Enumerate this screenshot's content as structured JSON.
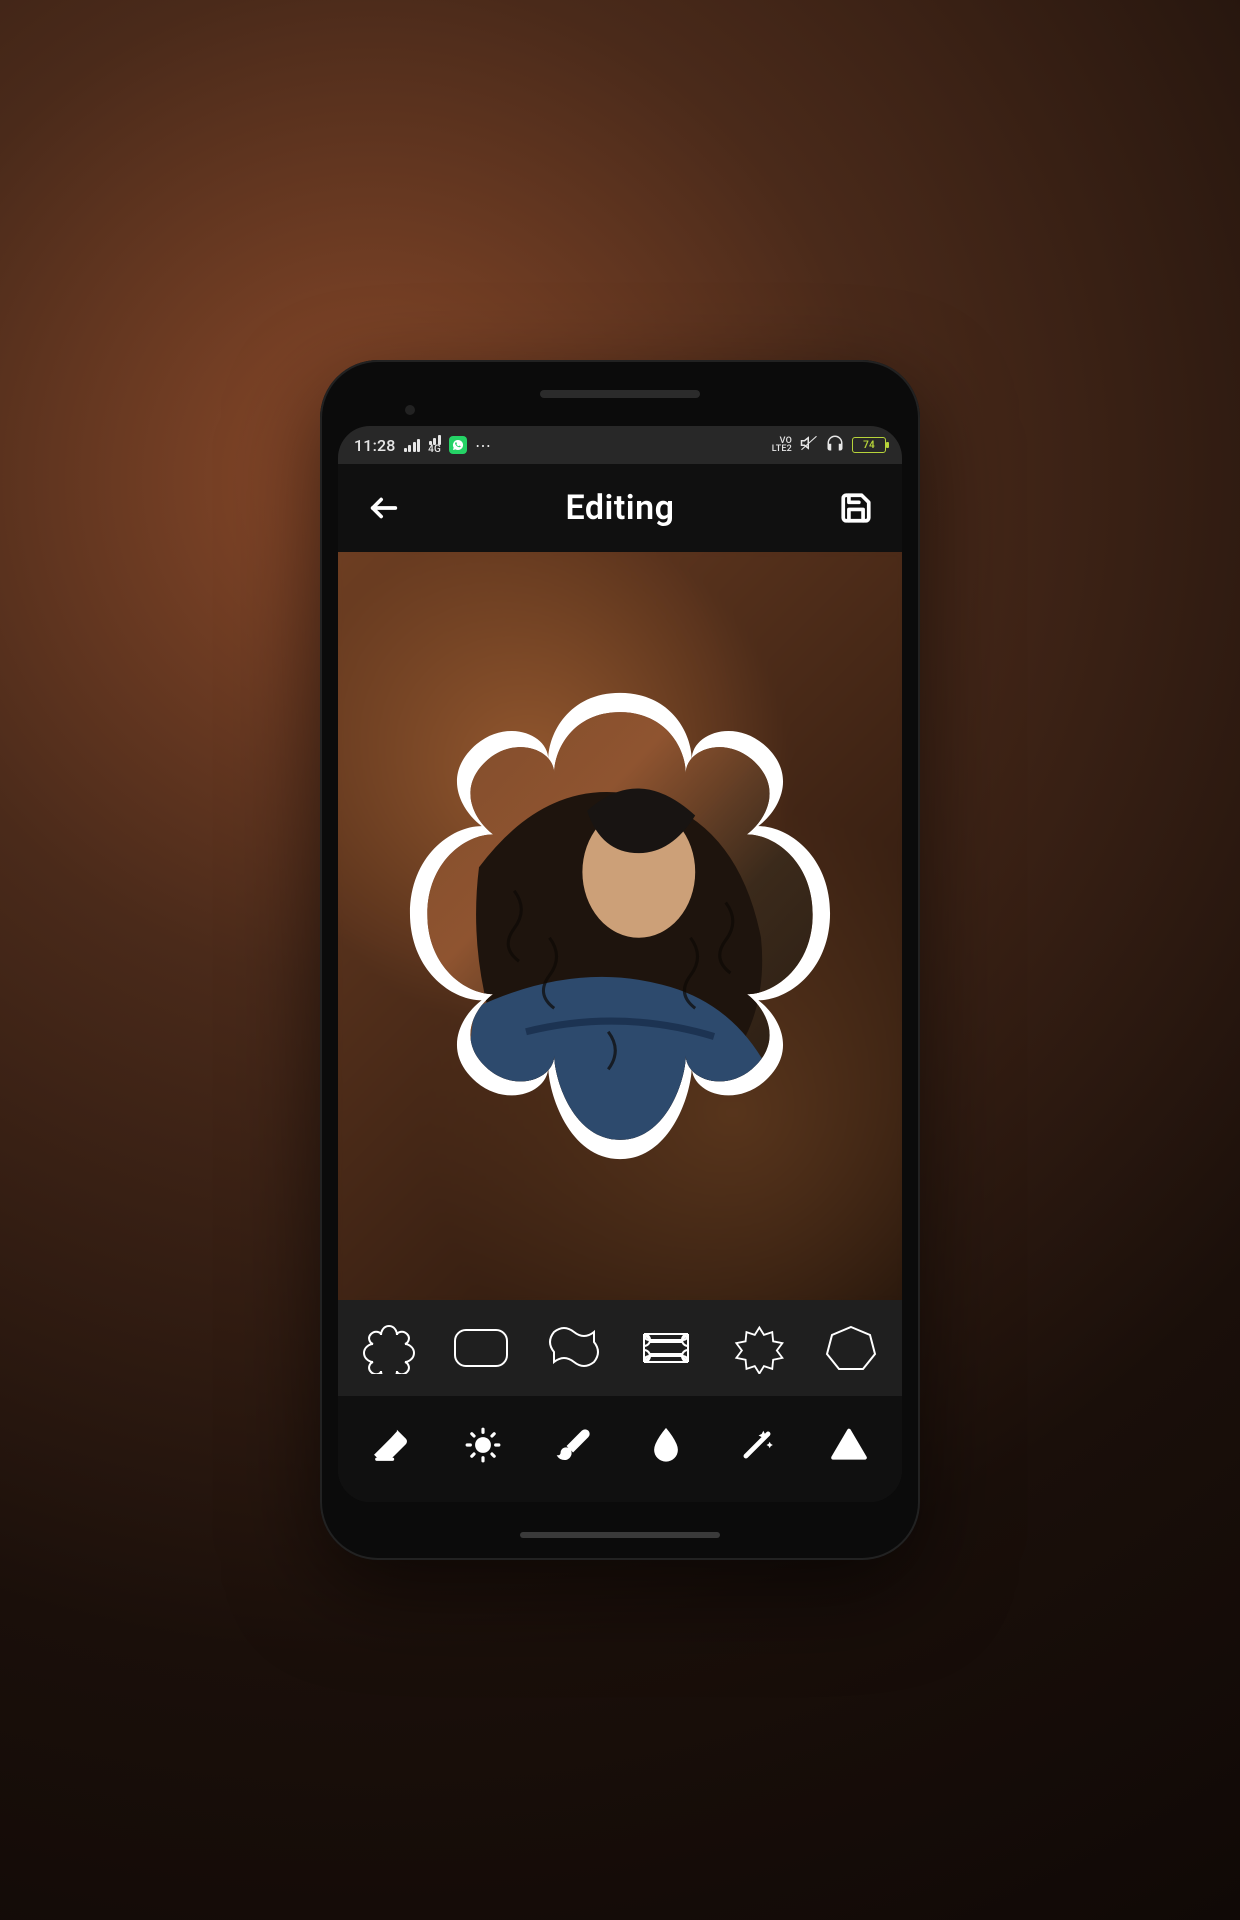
{
  "statusbar": {
    "time": "11:28",
    "network_type": "4G",
    "volte": "VO\nLTE2",
    "battery_percent": "74",
    "more_indicator": "⋯"
  },
  "appbar": {
    "title": "Editing"
  },
  "shapes": [
    {
      "name": "badge-flower"
    },
    {
      "name": "rounded-rect"
    },
    {
      "name": "wavy-square"
    },
    {
      "name": "plaque-rect"
    },
    {
      "name": "eight-point-star"
    },
    {
      "name": "heptagon"
    }
  ],
  "tools": [
    {
      "name": "eraser",
      "icon": "eraser-icon"
    },
    {
      "name": "brightness",
      "icon": "sun-icon"
    },
    {
      "name": "brush",
      "icon": "brush-icon"
    },
    {
      "name": "blur",
      "icon": "drop-icon"
    },
    {
      "name": "magic",
      "icon": "wand-icon"
    },
    {
      "name": "triangle",
      "icon": "triangle-icon"
    }
  ],
  "colors": {
    "accent": "#ffffff",
    "panel_bg": "#1f1f1f",
    "bar_bg": "#101010",
    "battery": "#b7d43a"
  }
}
